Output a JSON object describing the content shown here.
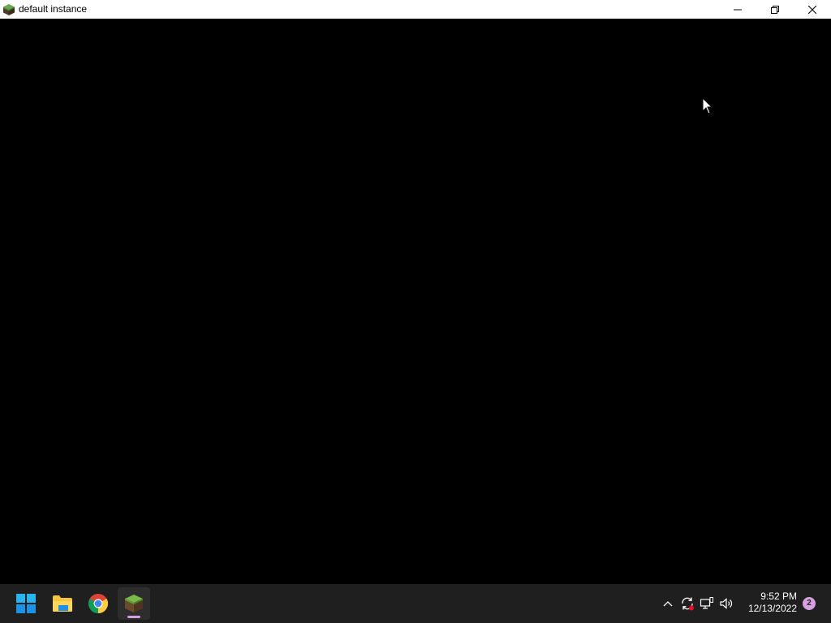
{
  "window": {
    "title": "default instance",
    "icon": "minecraft-grass-block-icon",
    "controls": {
      "minimize": "minimize-icon",
      "restore": "restore-icon",
      "close": "close-icon"
    }
  },
  "taskbar": {
    "apps": [
      {
        "name": "Start",
        "icon": "windows-start-icon"
      },
      {
        "name": "File Explorer",
        "icon": "folder-icon"
      },
      {
        "name": "Google Chrome",
        "icon": "chrome-icon"
      },
      {
        "name": "Minecraft",
        "icon": "minecraft-launcher-icon",
        "active": true
      }
    ],
    "tray": {
      "icons": [
        "chevron-up-icon",
        "sync-icon",
        "network-icon",
        "volume-icon"
      ]
    },
    "clock": {
      "time": "9:52 PM",
      "date": "12/13/2022"
    },
    "notifications": {
      "count": "2"
    }
  },
  "colors": {
    "titlebar": "#ffffff",
    "content": "#000000",
    "taskbar": "#1f1f1f",
    "accent": "#d6a0e0"
  }
}
